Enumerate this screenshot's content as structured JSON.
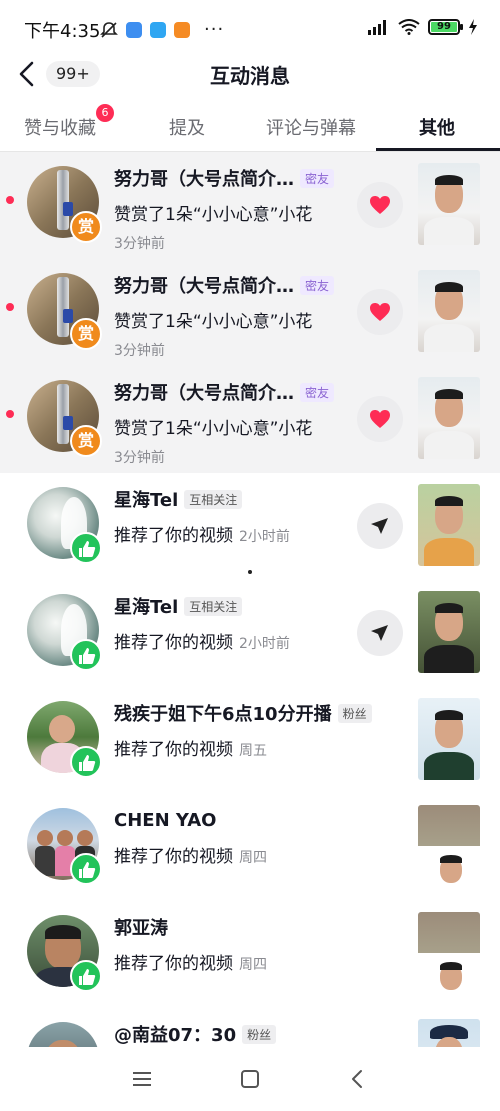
{
  "status_bar": {
    "time": "下午4:35",
    "dots": "···",
    "battery": "99"
  },
  "header": {
    "back_badge": "99+",
    "title": "互动消息"
  },
  "tabs": [
    {
      "label": "赞与收藏",
      "badge": "6"
    },
    {
      "label": "提及"
    },
    {
      "label": "评论与弹幕"
    },
    {
      "label": "其他",
      "active": true
    }
  ],
  "notifications": [
    {
      "username": "努力哥（大号点简介…",
      "tag": "密友",
      "action": "赞赏了1朵“小小心意”小花",
      "time": "3分钟前",
      "unread": true
    },
    {
      "username": "努力哥（大号点简介…",
      "tag": "密友",
      "action": "赞赏了1朵“小小心意”小花",
      "time": "3分钟前",
      "unread": true
    },
    {
      "username": "努力哥（大号点简介…",
      "tag": "密友",
      "action": "赞赏了1朵“小小心意”小花",
      "time": "3分钟前",
      "unread": true
    },
    {
      "username": "星海Tel",
      "tag": "互相关注",
      "action": "推荐了你的视频",
      "time": "2小时前"
    },
    {
      "username": "星海Tel",
      "tag": "互相关注",
      "action": "推荐了你的视频",
      "time": "2小时前"
    },
    {
      "username": "残疾于姐下午6点10分开播",
      "tag": "粉丝",
      "action": "推荐了你的视频",
      "time": "周五"
    },
    {
      "username": "CHEN YAO",
      "action": "推荐了你的视频",
      "time": "周四"
    },
    {
      "username": "郭亚涛",
      "action": "推荐了你的视频",
      "time": "周四"
    },
    {
      "username": "@南益07：30",
      "tag": "粉丝"
    }
  ],
  "icons": {
    "reward_badge": "赏",
    "colors": {
      "accent": "#fe2c55",
      "reward": "#f08a1c",
      "thumb": "#22c35a",
      "tag_purple": "#8a63d2"
    }
  }
}
